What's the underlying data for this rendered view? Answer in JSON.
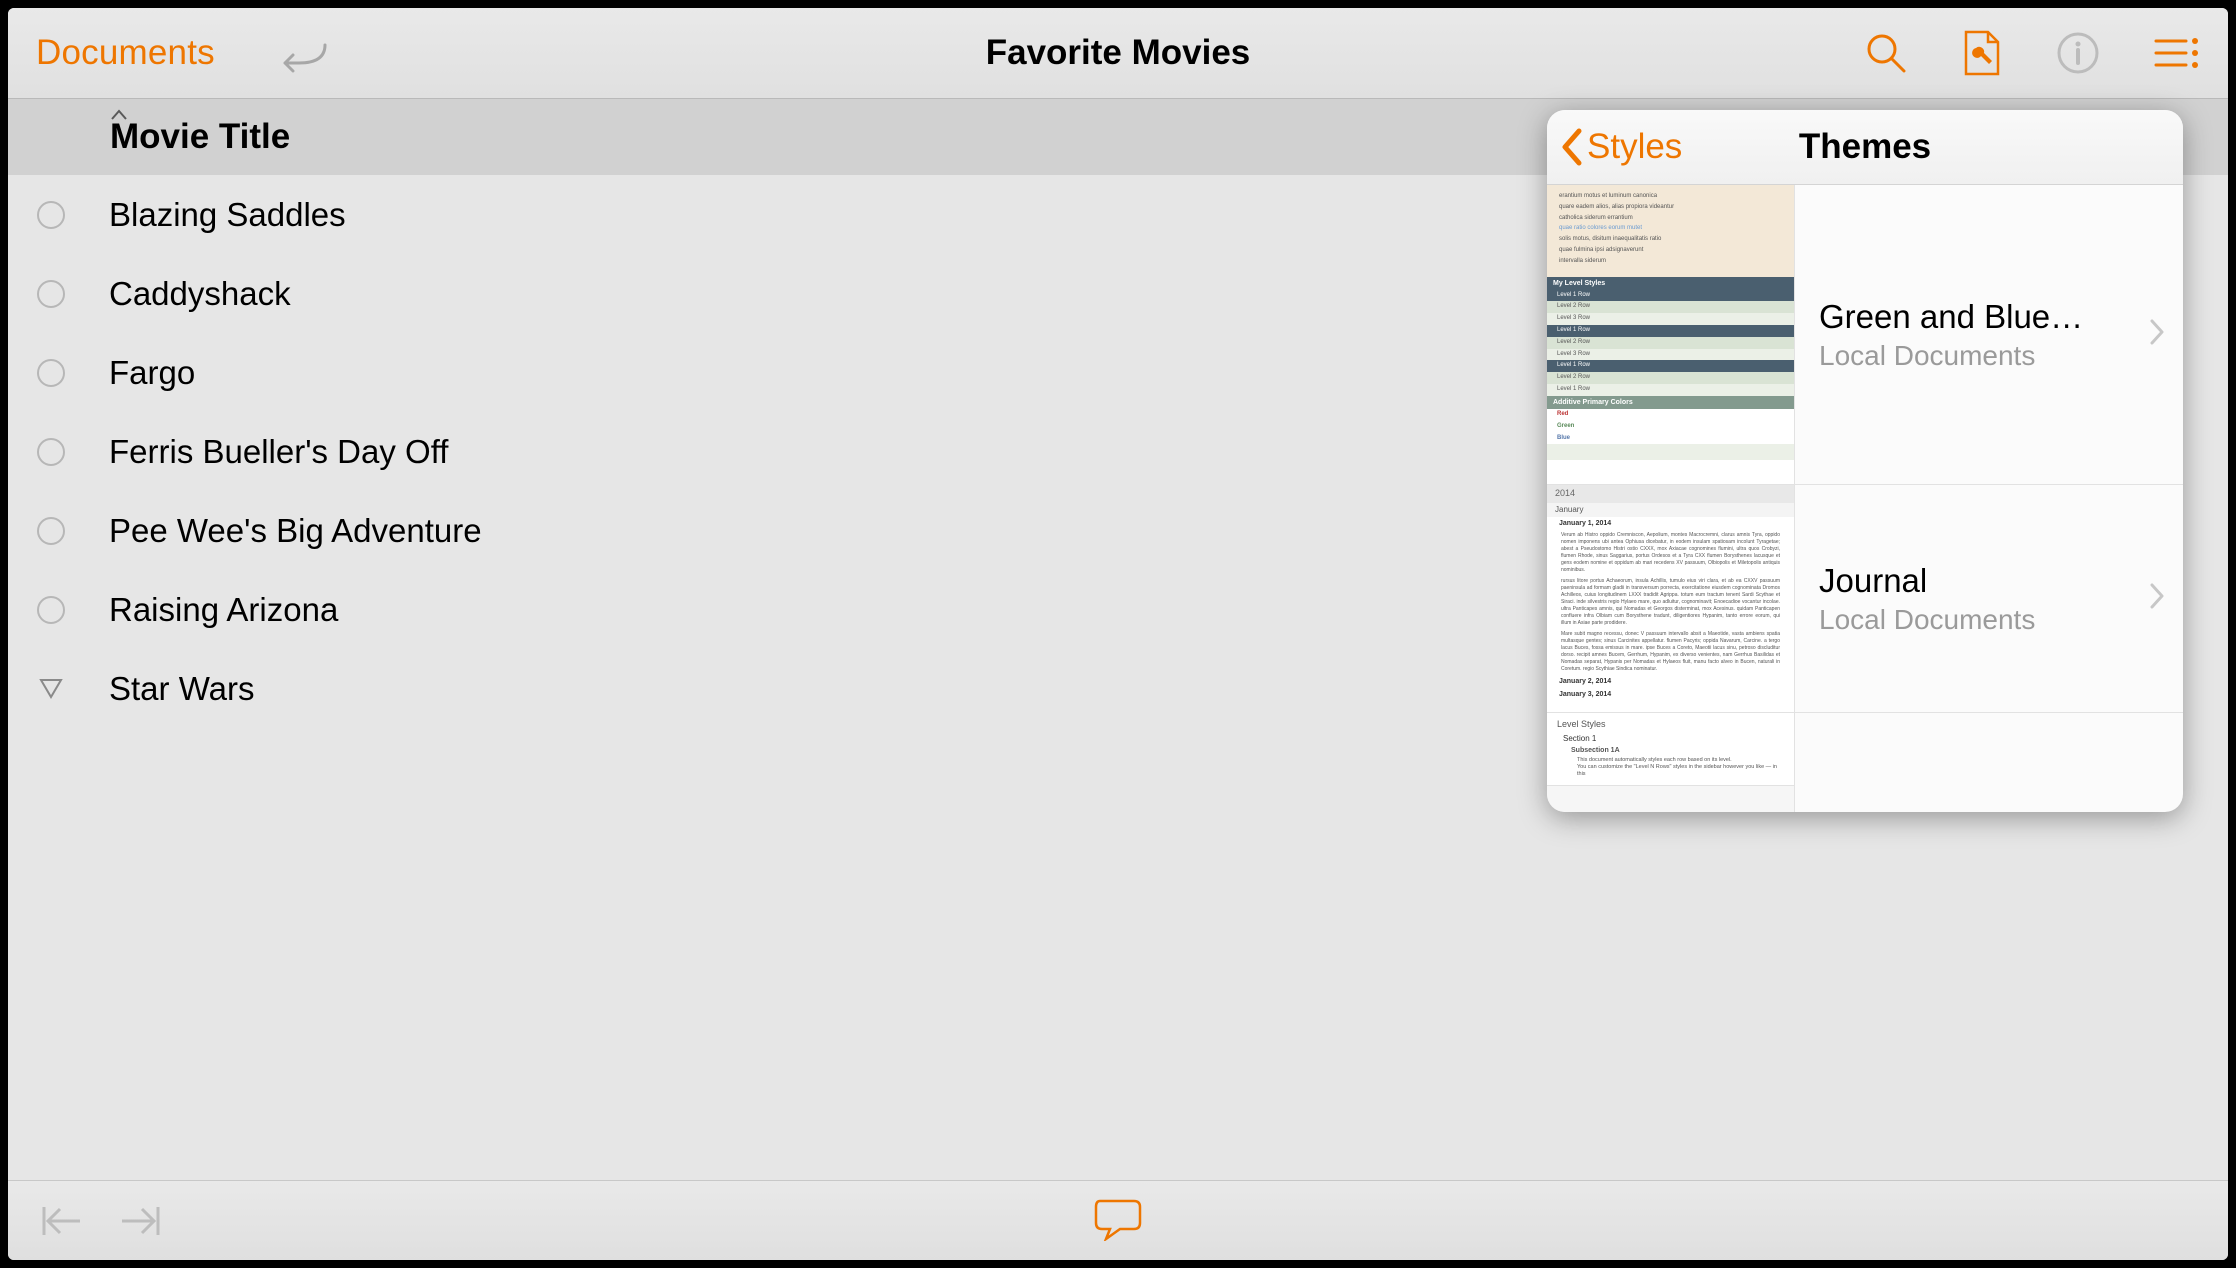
{
  "toolbar": {
    "documents_label": "Documents",
    "title": "Favorite Movies"
  },
  "column_header": "Movie Title",
  "rows": [
    {
      "title": "Blazing Saddles",
      "expandable": false
    },
    {
      "title": "Caddyshack",
      "expandable": false
    },
    {
      "title": "Fargo",
      "expandable": false
    },
    {
      "title": "Ferris Bueller's Day Off",
      "expandable": false
    },
    {
      "title": "Pee Wee's Big Adventure",
      "expandable": false
    },
    {
      "title": "Raising Arizona",
      "expandable": false
    },
    {
      "title": "Star Wars",
      "expandable": true
    }
  ],
  "popover": {
    "back_label": "Styles",
    "title": "Themes",
    "themes": [
      {
        "name": "Green and Blue…",
        "subtitle": "Local Documents"
      },
      {
        "name": "Journal",
        "subtitle": "Local Documents"
      }
    ],
    "thumb_a": {
      "lorem": [
        "erantium motus et luminum canonica",
        "quare eadem alios, alias propiora videantur",
        "catholica siderum errantium",
        "quae ratio colores eorum mutet",
        "solis motus, disitum inaequalitatis ratio",
        "quae fulmina ipsi adsignaverunt",
        "intervalla siderum"
      ],
      "my_level": "My Level Styles",
      "l1": "Level 1 Row",
      "l2": "Level 2 Row",
      "l3": "Level 3 Row",
      "apc": "Additive Primary Colors",
      "red": "Red",
      "green": "Green",
      "blue": "Blue"
    },
    "thumb_b": {
      "year": "2014",
      "month": "January",
      "d1": "January 1, 2014",
      "d2": "January 2, 2014",
      "d3": "January 3, 2014"
    },
    "thumb_c": {
      "ls": "Level Styles",
      "s1": "Section 1",
      "s2": "Subsection 1A",
      "t1": "This document automatically styles each row based on its level.",
      "t2": "You can customize the \"Level N Rows\" styles in the sidebar however you like — in this"
    }
  }
}
